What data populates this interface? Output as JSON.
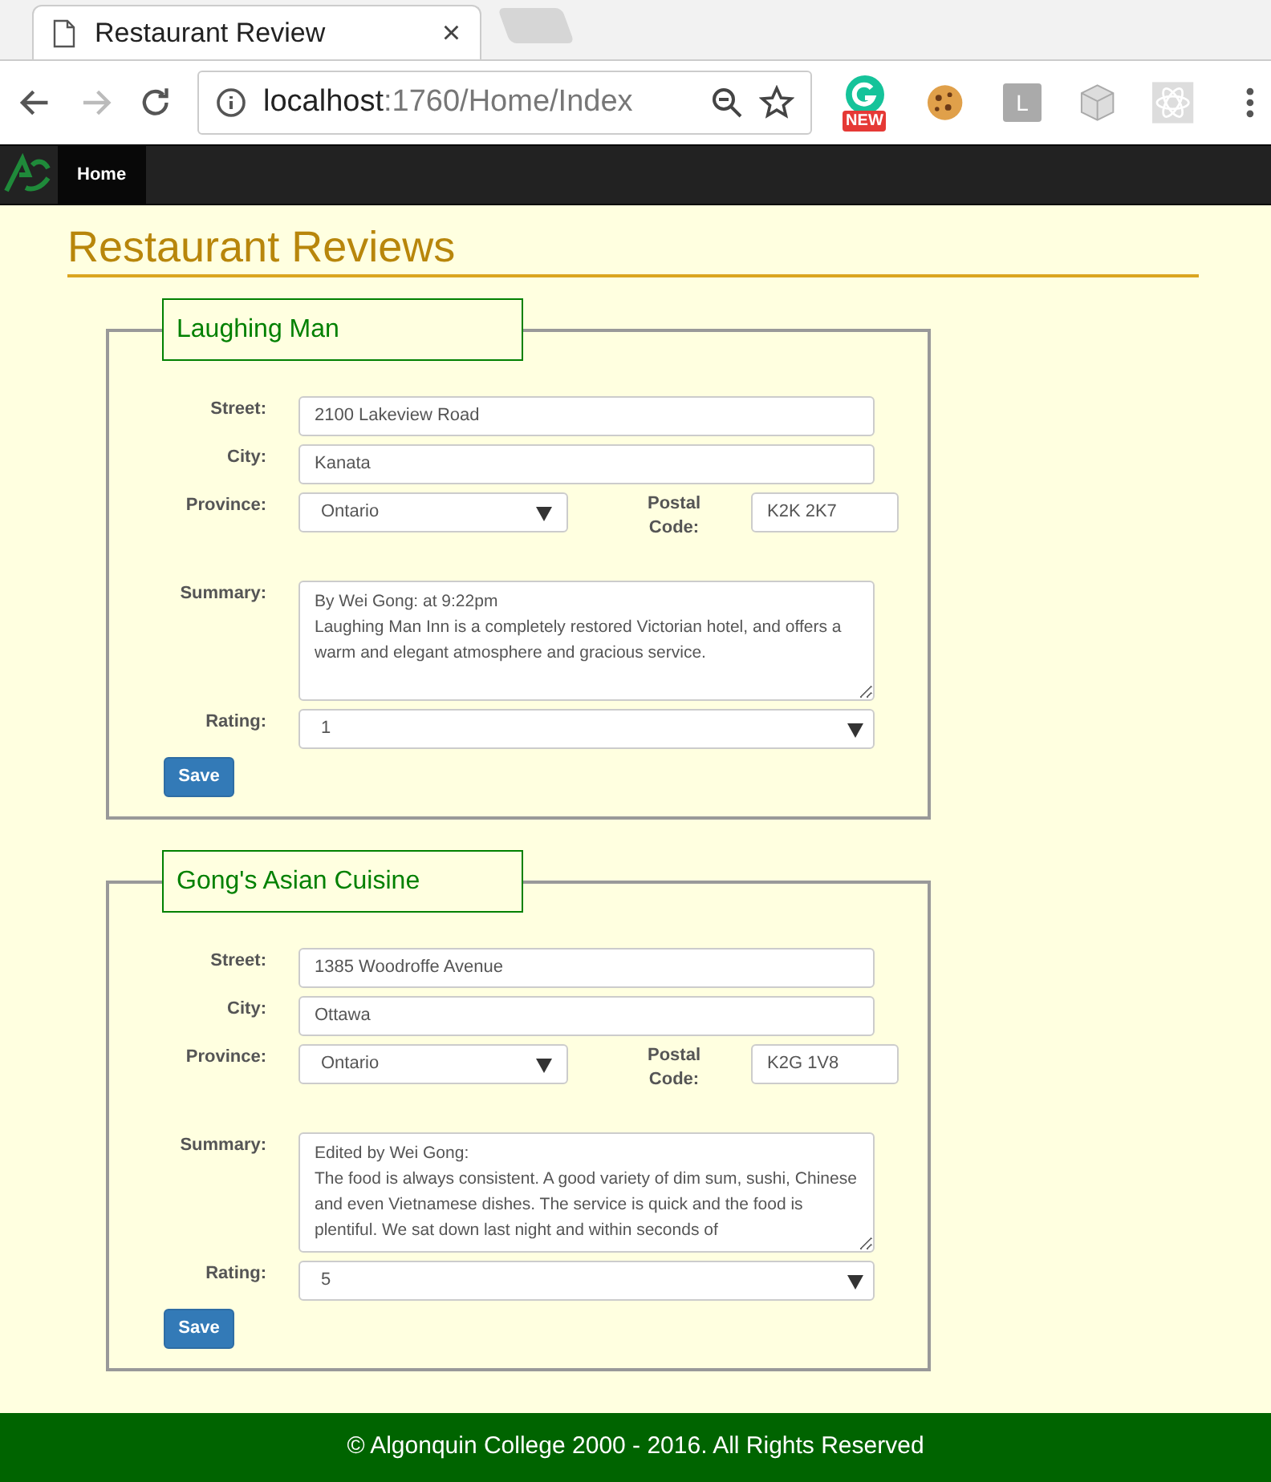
{
  "browser": {
    "tab_title": "Restaurant Review",
    "close": "×",
    "address_host": "localhost",
    "address_path": ":1760/Home/Index",
    "extension_badge": "NEW",
    "extension_letter": "L"
  },
  "navbar": {
    "items": [
      {
        "label": "Home",
        "selected": true
      }
    ]
  },
  "page_title": "Restaurant Reviews",
  "restaurants": [
    {
      "name": "Laughing Man",
      "street_label": "Street:",
      "street": "2100 Lakeview Road",
      "city_label": "City:",
      "city": "Kanata",
      "province_label": "Province:",
      "province": "Ontario",
      "postal_label": "Postal Code:",
      "postal_code": "K2K 2K7",
      "summary_label": "Summary:",
      "summary": "By Wei Gong: at 9:22pm\nLaughing Man Inn is a completely restored Victorian hotel, and offers a warm and elegant atmosphere and gracious service.",
      "rating_label": "Rating:",
      "rating": "1",
      "save": "Save"
    },
    {
      "name": "Gong's Asian Cuisine",
      "street_label": "Street:",
      "street": "1385 Woodroffe Avenue",
      "city_label": "City:",
      "city": "Ottawa",
      "province_label": "Province:",
      "province": "Ontario",
      "postal_label": "Postal Code:",
      "postal_code": "K2G 1V8",
      "summary_label": "Summary:",
      "summary": "Edited by Wei Gong:\nThe food is always consistent. A good variety of dim sum, sushi, Chinese and even Vietnamese dishes. The service is quick and the food is plentiful. We sat down last night and within seconds of",
      "rating_label": "Rating:",
      "rating": "5",
      "save": "Save"
    }
  ],
  "footer": "© Algonquin College 2000 - 2016. All Rights Reserved"
}
